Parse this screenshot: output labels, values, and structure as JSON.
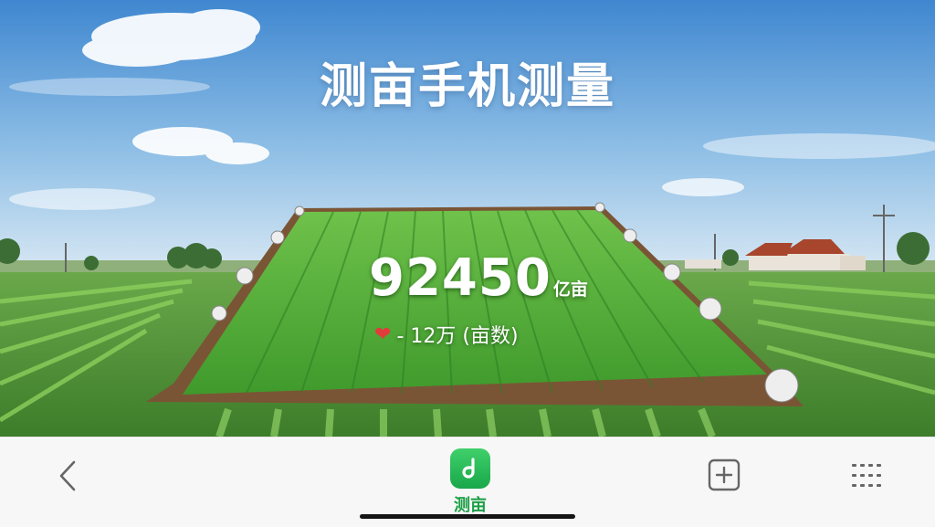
{
  "scene": {
    "title": "测亩手机测量",
    "measurement": {
      "value": "92450",
      "unit": "亿亩",
      "subtext": "- 12万 (亩数)"
    }
  },
  "bottom_bar": {
    "back_icon": "chevron-left-icon",
    "app": {
      "label": "测亩",
      "icon": "app-logo-icon"
    },
    "add_icon": "plus-square-icon",
    "menu_icon": "grid-dots-icon"
  },
  "colors": {
    "sky_top": "#3f87d0",
    "sky_bottom": "#cfe3f3",
    "field_green": "#4fae35",
    "app_green": "#19a74a",
    "heart_red": "#e23b3b"
  }
}
